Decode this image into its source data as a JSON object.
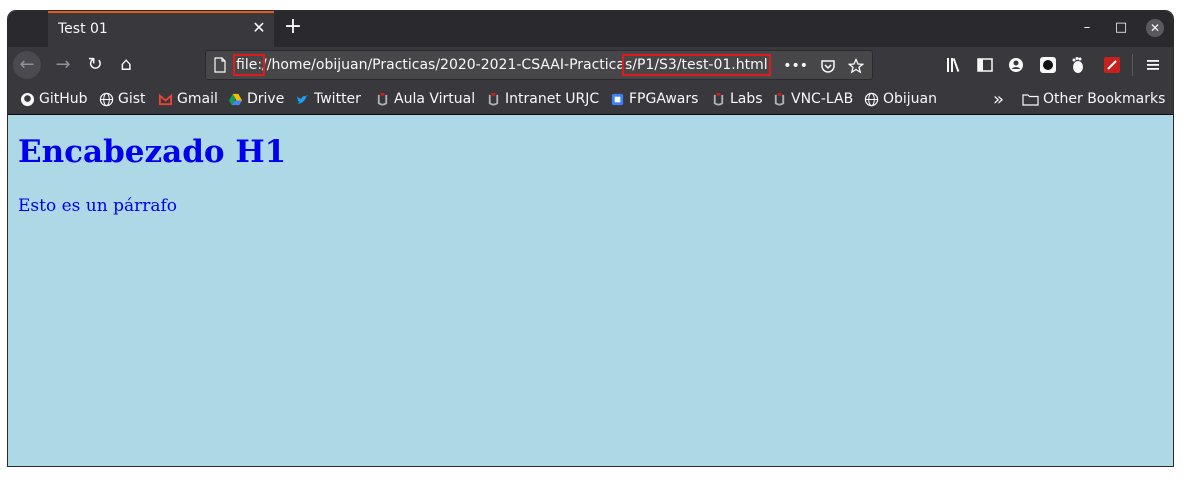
{
  "tab": {
    "title": "Test 01",
    "close": "✕"
  },
  "new_tab": "+",
  "window_controls": {
    "minimize": "–",
    "maximize": "□",
    "close": "✕"
  },
  "nav": {
    "back": "←",
    "forward": "→",
    "reload": "↻",
    "home": "⌂"
  },
  "url": {
    "scheme": "file:",
    "middle": "//home/obijuan/Practicas/2020-2021-CSAAI-Practica",
    "tail": "s/P1/S3/test-01.html",
    "more_actions": "•••"
  },
  "bookmarks": [
    {
      "label": "GitHub",
      "icon": "github-icon"
    },
    {
      "label": "Gist",
      "icon": "globe-icon"
    },
    {
      "label": "Gmail",
      "icon": "gmail-icon"
    },
    {
      "label": "Drive",
      "icon": "drive-icon"
    },
    {
      "label": "Twitter",
      "icon": "twitter-icon"
    },
    {
      "label": "Aula Virtual",
      "icon": "urjc-icon"
    },
    {
      "label": "Intranet URJC",
      "icon": "urjc-icon"
    },
    {
      "label": "FPGAwars",
      "icon": "fpgawars-icon"
    },
    {
      "label": "Labs",
      "icon": "urjc-icon"
    },
    {
      "label": "VNC-LAB",
      "icon": "urjc-icon"
    },
    {
      "label": "Obijuan",
      "icon": "globe-icon"
    }
  ],
  "bookmarks_overflow": "»",
  "other_bookmarks": "Other Bookmarks",
  "page": {
    "heading": "Encabezado H1",
    "paragraph": "Esto es un párrafo"
  },
  "colors": {
    "page_background": "#add8e6",
    "text": "#0000ee",
    "highlight_box": "#e01b1b",
    "tab_accent": "#e55b17"
  }
}
